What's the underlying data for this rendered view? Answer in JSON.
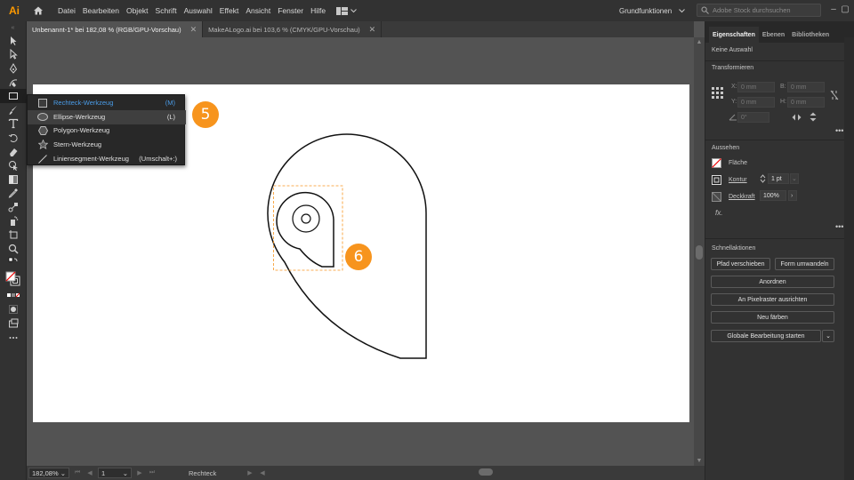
{
  "app": {
    "logo": "Ai",
    "menu": [
      "Datei",
      "Bearbeiten",
      "Objekt",
      "Schrift",
      "Auswahl",
      "Effekt",
      "Ansicht",
      "Fenster",
      "Hilfe"
    ],
    "workspace": "Grundfunktionen",
    "stock_search_placeholder": "Adobe Stock durchsuchen",
    "accent": "#ff9a00"
  },
  "tabs": [
    {
      "label": "Unbenannt-1* bei 182,08 % (RGB/GPU-Vorschau)",
      "active": true
    },
    {
      "label": "MakeALogo.ai bei 103,6 % (CMYK/GPU-Vorschau)",
      "active": false
    }
  ],
  "flyout": {
    "items": [
      {
        "label": "Rechteck-Werkzeug",
        "key": "(M)",
        "icon": "rectangle-icon",
        "selected": true
      },
      {
        "label": "Ellipse-Werkzeug",
        "key": "(L)",
        "icon": "ellipse-icon",
        "hover": true
      },
      {
        "label": "Polygon-Werkzeug",
        "key": "",
        "icon": "polygon-icon"
      },
      {
        "label": "Stern-Werkzeug",
        "key": "",
        "icon": "star-icon"
      },
      {
        "label": "Liniensegment-Werkzeug",
        "key": "(Umschalt+:)",
        "icon": "line-icon"
      }
    ]
  },
  "badges": {
    "first": "5",
    "second": "6",
    "color": "#f7941d"
  },
  "statusbar": {
    "zoom": "182,08%",
    "page": "1",
    "tool": "Rechteck"
  },
  "panel": {
    "tabs": [
      "Eigenschaften",
      "Ebenen",
      "Bibliotheken"
    ],
    "no_selection": "Keine Auswahl",
    "transform": {
      "title": "Transformieren",
      "x_label": "X:",
      "x_value": "0 mm",
      "y_label": "Y:",
      "y_value": "0 mm",
      "b_label": "B:",
      "b_value": "0 mm",
      "h_label": "H:",
      "h_value": "0 mm",
      "angle_value": "0°"
    },
    "appearance": {
      "title": "Aussehen",
      "fill_label": "Fläche",
      "stroke_label": "Kontur",
      "stroke_value": "1 pt",
      "opacity_label": "Deckkraft",
      "opacity_value": "100%",
      "fx": "fx."
    },
    "quick_actions": {
      "title": "Schnellaktionen",
      "path_offset": "Pfad verschieben",
      "convert_shape": "Form umwandeln",
      "arrange": "Anordnen",
      "align_pixel": "An Pixelraster ausrichten",
      "recolor": "Neu färben",
      "global_edit": "Globale Bearbeitung starten"
    }
  }
}
